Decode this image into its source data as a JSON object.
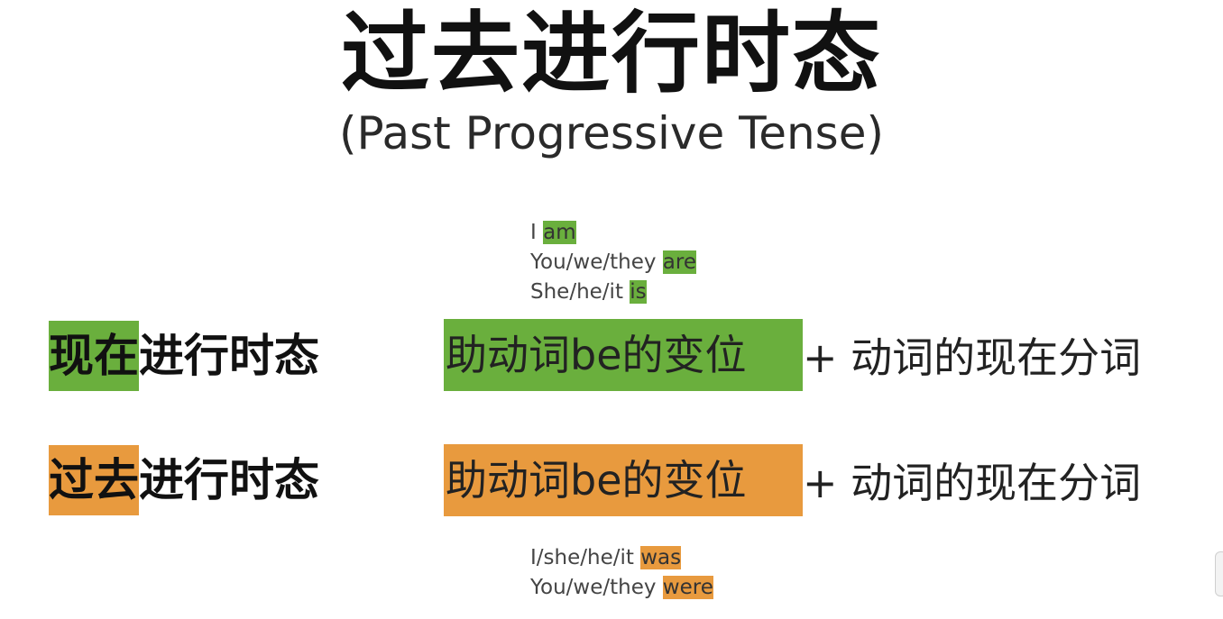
{
  "title": "过去进行时态",
  "subtitle": "(Past Progressive Tense)",
  "present_conjugations": [
    {
      "subject": "I ",
      "verb": "am"
    },
    {
      "subject": "You/we/they ",
      "verb": "are"
    },
    {
      "subject": "She/he/it ",
      "verb": "is"
    }
  ],
  "past_conjugations": [
    {
      "subject": "I/she/he/it ",
      "verb": "was"
    },
    {
      "subject": "You/we/they ",
      "verb": "were"
    }
  ],
  "rows": [
    {
      "label_highlight": "现在",
      "label_rest": "进行时态",
      "formula_box": "助动词be的变位",
      "formula_rest": "+ 动词的现在分词",
      "color": "#6aaf3d"
    },
    {
      "label_highlight": "过去",
      "label_rest": "进行时态",
      "formula_box": "助动词be的变位",
      "formula_rest": "+ 动词的现在分词",
      "color": "#e89a3e"
    }
  ],
  "colors": {
    "green": "#6aaf3d",
    "orange": "#e89a3e"
  }
}
